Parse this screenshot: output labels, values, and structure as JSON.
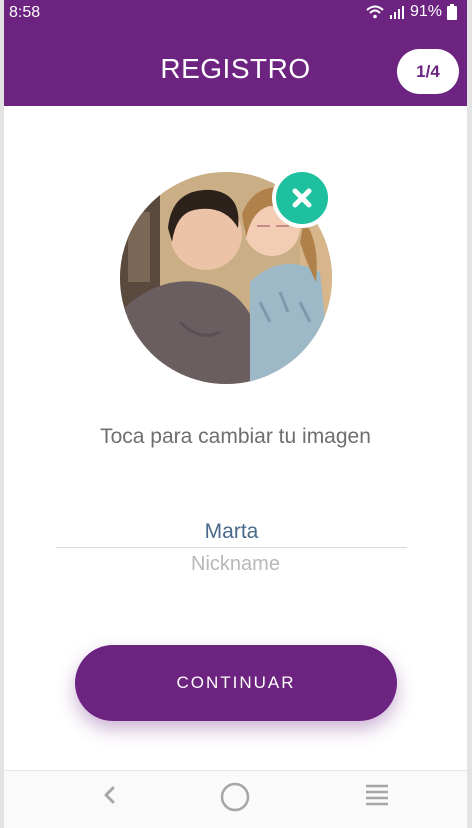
{
  "status_bar": {
    "time": "8:58",
    "battery": "91%"
  },
  "header": {
    "title": "REGISTRO",
    "step": "1/4"
  },
  "profile": {
    "change_image_hint": "Toca para cambiar tu imagen"
  },
  "form": {
    "nickname_value": "Marta",
    "nickname_label": "Nickname"
  },
  "actions": {
    "continue_label": "CONTINUAR"
  },
  "icons": {
    "remove_photo": "close-icon",
    "back": "back-icon",
    "home": "home-icon",
    "menu": "menu-icon",
    "wifi": "wifi-icon",
    "signal": "signal-icon",
    "battery": "battery-icon"
  },
  "colors": {
    "brand": "#6d2380",
    "accent": "#1ec0a0",
    "input_text": "#4a6a8c"
  }
}
